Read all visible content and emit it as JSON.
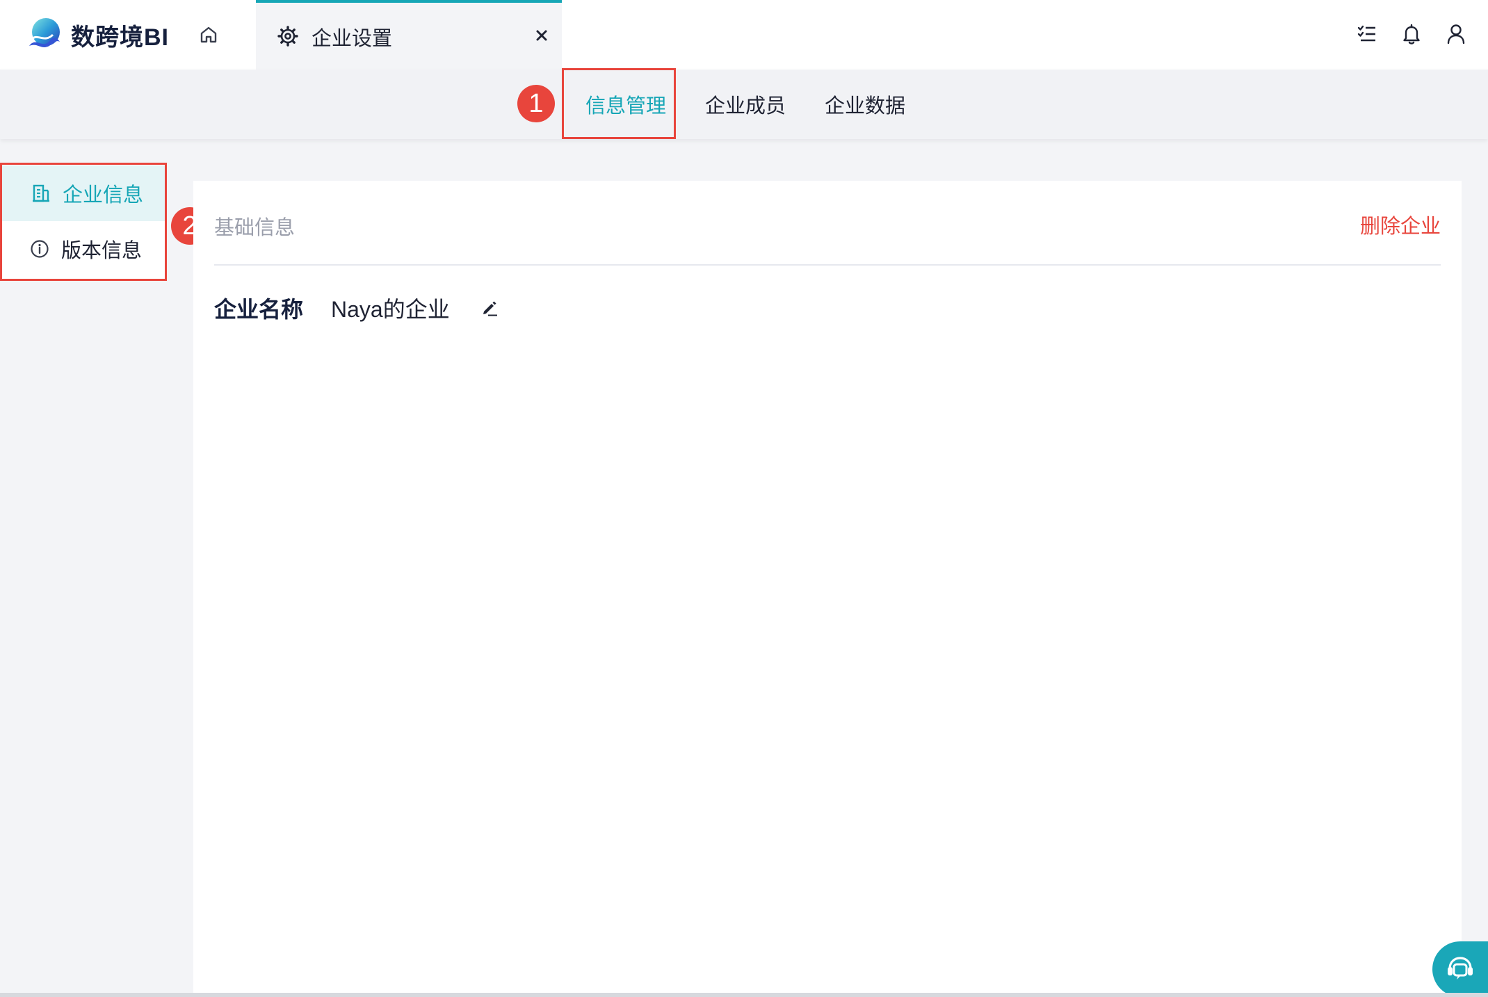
{
  "app": {
    "brand_name": "数跨境BI",
    "accent_color": "#16a6b6",
    "alert_color": "#e8453c"
  },
  "header": {
    "home_icon": "home-icon",
    "tab": {
      "label": "企业设置",
      "icon": "gear-icon",
      "close_icon": "close-icon"
    },
    "actions": [
      {
        "icon": "task-list-icon"
      },
      {
        "icon": "bell-icon"
      },
      {
        "icon": "user-icon"
      }
    ]
  },
  "subnav": {
    "items": [
      {
        "label": "信息管理",
        "active": true
      },
      {
        "label": "企业成员",
        "active": false
      },
      {
        "label": "企业数据",
        "active": false
      }
    ]
  },
  "annotations": {
    "badge1": "1",
    "badge2": "2"
  },
  "sidebar": {
    "items": [
      {
        "label": "企业信息",
        "icon": "building-icon",
        "active": true
      },
      {
        "label": "版本信息",
        "icon": "info-icon",
        "active": false
      }
    ]
  },
  "main": {
    "section_title": "基础信息",
    "delete_label": "删除企业",
    "fields": [
      {
        "label": "企业名称",
        "value": "Naya的企业",
        "edit_icon": "edit-icon"
      }
    ]
  },
  "chat": {
    "icon": "chat-support-icon"
  }
}
